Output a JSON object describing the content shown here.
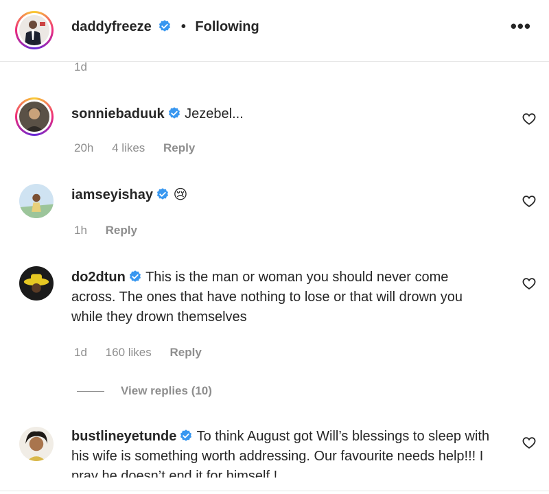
{
  "header": {
    "username": "daddyfreeze",
    "separator": "•",
    "follow_status": "Following",
    "more_icon": "more-horizontal-icon"
  },
  "top_time": "1d",
  "comments": [
    {
      "username": "sonniebaduuk",
      "text": "Jezebel...",
      "time": "20h",
      "likes": "4 likes",
      "reply": "Reply",
      "verified": true
    },
    {
      "username": "iamseyishay",
      "text": "",
      "emoji": "😢",
      "time": "1h",
      "reply": "Reply",
      "verified": true
    },
    {
      "username": "do2dtun",
      "text": "This is the man or woman you should never come across. The ones that have nothing to lose or that will drown you while they drown themselves",
      "time": "1d",
      "likes": "160 likes",
      "reply": "Reply",
      "verified": true,
      "view_replies": "View replies (10)"
    },
    {
      "username": "bustlineyetunde",
      "text": "To think August got Will’s blessings to sleep with his wife is something worth addressing. Our favourite needs help!!! I pray he doesn’t end it for himself !",
      "verified": true
    }
  ],
  "colors": {
    "verified": "#3897f0",
    "muted": "#8e8e8e",
    "text": "#262626"
  }
}
